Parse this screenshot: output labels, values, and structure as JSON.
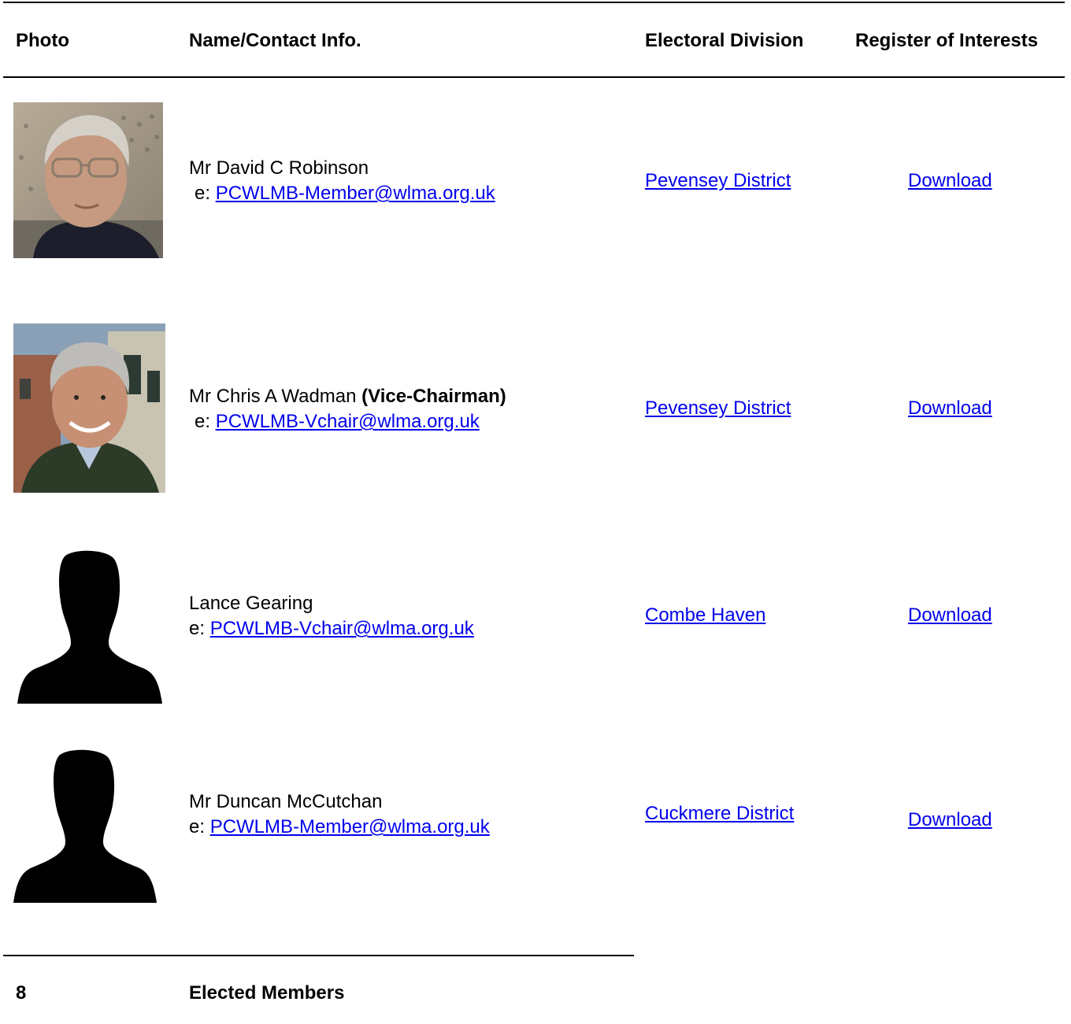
{
  "headers": {
    "photo": "Photo",
    "name_contact": "Name/Contact Info.",
    "electoral_division": "Electoral Division",
    "register_of_interests": "Register of Interests"
  },
  "members": [
    {
      "name": "Mr David C Robinson",
      "role": "",
      "email_prefix": "e: ",
      "email": "PCWLMB-Member@wlma.org.uk",
      "division": "Pevensey District",
      "register": "Download",
      "photo": "photo-portrait"
    },
    {
      "name": "Mr Chris A Wadman",
      "role": "(Vice-Chairman)",
      "email_prefix": "e: ",
      "email": "PCWLMB-Vchair@wlma.org.uk",
      "division": "Pevensey District",
      "register": "Download",
      "photo": "photo-portrait"
    },
    {
      "name": "Lance Gearing",
      "role": "",
      "email_prefix": "e: ",
      "email": "PCWLMB-Vchair@wlma.org.uk",
      "division": "Combe Haven",
      "register": "Download",
      "photo": "silhouette"
    },
    {
      "name": "Mr Duncan McCutchan",
      "role": "",
      "email_prefix": "e: ",
      "email": "PCWLMB-Member@wlma.org.uk",
      "division": "Cuckmere District",
      "register": "Download",
      "photo": "silhouette"
    }
  ],
  "footer": {
    "count": "8",
    "label": "Elected Members"
  },
  "colors": {
    "link": "#0000ee",
    "rule": "#000000"
  }
}
